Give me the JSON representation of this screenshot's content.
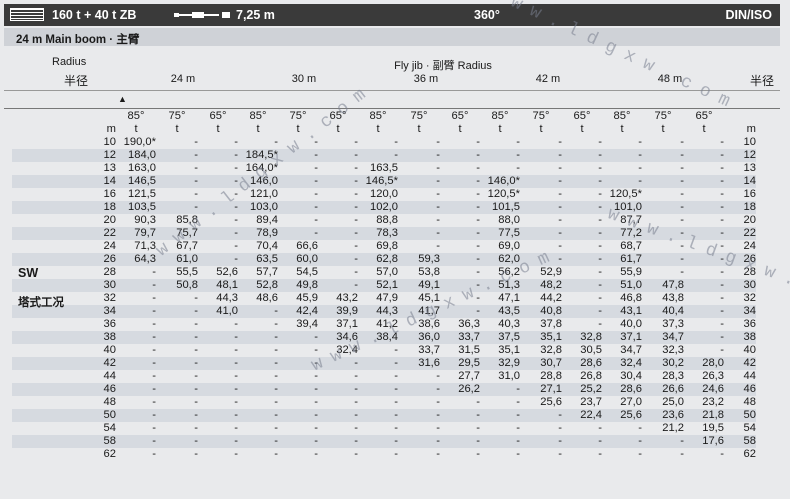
{
  "header": {
    "capacity_label": "160 t + 40 t ZB",
    "boom_length": "7,25 m",
    "slew": "360°",
    "standard": "DIN/ISO"
  },
  "subheader": {
    "label": "24 m  Main boom · 主臂"
  },
  "columns": {
    "radius_label_en": "Radius",
    "radius_label_cn": "半径",
    "radius_label_cn_right": "半径",
    "jib_title": "Fly jib · 副臂 Radius",
    "jib_lengths": [
      "24 m",
      "30 m",
      "36 m",
      "42 m",
      "48 m"
    ],
    "triangle": "▲",
    "angles": [
      "85°",
      "75°",
      "65°",
      "85°",
      "75°",
      "65°",
      "85°",
      "75°",
      "65°",
      "85°",
      "75°",
      "65°",
      "85°",
      "75°",
      "65°"
    ],
    "unit_m": "m",
    "unit_t": "t"
  },
  "side_label": {
    "code": "SW",
    "cn": "塔式工况"
  },
  "watermark": "www.ldgxw.com",
  "rows": [
    {
      "r": "10",
      "v": [
        "190,0*",
        "-",
        "-",
        "-",
        "-",
        "-",
        "-",
        "-",
        "-",
        "-",
        "-",
        "-",
        "-",
        "-",
        "-"
      ]
    },
    {
      "r": "12",
      "v": [
        "184,0",
        "-",
        "-",
        "184,5*",
        "-",
        "-",
        "-",
        "-",
        "-",
        "-",
        "-",
        "-",
        "-",
        "-",
        "-"
      ]
    },
    {
      "r": "13",
      "v": [
        "163,0",
        "-",
        "-",
        "164,0*",
        "-",
        "-",
        "163,5",
        "-",
        "-",
        "-",
        "-",
        "-",
        "-",
        "-",
        "-"
      ]
    },
    {
      "r": "14",
      "v": [
        "146,5",
        "-",
        "-",
        "146,0",
        "-",
        "-",
        "146,5*",
        "-",
        "-",
        "146,0*",
        "-",
        "-",
        "-",
        "-",
        "-"
      ]
    },
    {
      "r": "16",
      "v": [
        "121,5",
        "-",
        "-",
        "121,0",
        "-",
        "-",
        "120,0",
        "-",
        "-",
        "120,5*",
        "-",
        "-",
        "120,5*",
        "-",
        "-"
      ]
    },
    {
      "r": "18",
      "v": [
        "103,5",
        "-",
        "-",
        "103,0",
        "-",
        "-",
        "102,0",
        "-",
        "-",
        "101,5",
        "-",
        "-",
        "101,0",
        "-",
        "-"
      ]
    },
    {
      "r": "20",
      "v": [
        "90,3",
        "85,8",
        "-",
        "89,4",
        "-",
        "-",
        "88,8",
        "-",
        "-",
        "88,0",
        "-",
        "-",
        "87,7",
        "-",
        "-"
      ]
    },
    {
      "r": "22",
      "v": [
        "79,7",
        "75,7",
        "-",
        "78,9",
        "-",
        "-",
        "78,3",
        "-",
        "-",
        "77,5",
        "-",
        "-",
        "77,2",
        "-",
        "-"
      ]
    },
    {
      "r": "24",
      "v": [
        "71,3",
        "67,7",
        "-",
        "70,4",
        "66,6",
        "-",
        "69,8",
        "-",
        "-",
        "69,0",
        "-",
        "-",
        "68,7",
        "-",
        "-"
      ]
    },
    {
      "r": "26",
      "v": [
        "64,3",
        "61,0",
        "-",
        "63,5",
        "60,0",
        "-",
        "62,8",
        "59,3",
        "-",
        "62,0",
        "-",
        "-",
        "61,7",
        "-",
        "-"
      ]
    },
    {
      "r": "28",
      "v": [
        "-",
        "55,5",
        "52,6",
        "57,7",
        "54,5",
        "-",
        "57,0",
        "53,8",
        "-",
        "56,2",
        "52,9",
        "-",
        "55,9",
        "-",
        "-"
      ]
    },
    {
      "r": "30",
      "v": [
        "-",
        "50,8",
        "48,1",
        "52,8",
        "49,8",
        "-",
        "52,1",
        "49,1",
        "-",
        "51,3",
        "48,2",
        "-",
        "51,0",
        "47,8",
        "-"
      ]
    },
    {
      "r": "32",
      "v": [
        "-",
        "-",
        "44,3",
        "48,6",
        "45,9",
        "43,2",
        "47,9",
        "45,1",
        "-",
        "47,1",
        "44,2",
        "-",
        "46,8",
        "43,8",
        "-"
      ]
    },
    {
      "r": "34",
      "v": [
        "-",
        "-",
        "41,0",
        "-",
        "42,4",
        "39,9",
        "44,3",
        "41,7",
        "-",
        "43,5",
        "40,8",
        "-",
        "43,1",
        "40,4",
        "-"
      ]
    },
    {
      "r": "36",
      "v": [
        "-",
        "-",
        "-",
        "-",
        "39,4",
        "37,1",
        "41,2",
        "38,6",
        "36,3",
        "40,3",
        "37,8",
        "-",
        "40,0",
        "37,3",
        "-"
      ]
    },
    {
      "r": "38",
      "v": [
        "-",
        "-",
        "-",
        "-",
        "-",
        "34,6",
        "38,4",
        "36,0",
        "33,7",
        "37,5",
        "35,1",
        "32,8",
        "37,1",
        "34,7",
        "-"
      ]
    },
    {
      "r": "40",
      "v": [
        "-",
        "-",
        "-",
        "-",
        "-",
        "32,4",
        "-",
        "33,7",
        "31,5",
        "35,1",
        "32,8",
        "30,5",
        "34,7",
        "32,3",
        "-"
      ]
    },
    {
      "r": "42",
      "v": [
        "-",
        "-",
        "-",
        "-",
        "-",
        "-",
        "-",
        "31,6",
        "29,5",
        "32,9",
        "30,7",
        "28,6",
        "32,4",
        "30,2",
        "28,0"
      ]
    },
    {
      "r": "44",
      "v": [
        "-",
        "-",
        "-",
        "-",
        "-",
        "-",
        "-",
        "-",
        "27,7",
        "31,0",
        "28,8",
        "26,8",
        "30,4",
        "28,3",
        "26,3"
      ]
    },
    {
      "r": "46",
      "v": [
        "-",
        "-",
        "-",
        "-",
        "-",
        "-",
        "-",
        "-",
        "26,2",
        "-",
        "27,1",
        "25,2",
        "28,6",
        "26,6",
        "24,6"
      ]
    },
    {
      "r": "48",
      "v": [
        "-",
        "-",
        "-",
        "-",
        "-",
        "-",
        "-",
        "-",
        "-",
        "-",
        "25,6",
        "23,7",
        "27,0",
        "25,0",
        "23,2"
      ]
    },
    {
      "r": "50",
      "v": [
        "-",
        "-",
        "-",
        "-",
        "-",
        "-",
        "-",
        "-",
        "-",
        "-",
        "-",
        "22,4",
        "25,6",
        "23,6",
        "21,8"
      ]
    },
    {
      "r": "54",
      "v": [
        "-",
        "-",
        "-",
        "-",
        "-",
        "-",
        "-",
        "-",
        "-",
        "-",
        "-",
        "-",
        "-",
        "21,2",
        "19,5"
      ]
    },
    {
      "r": "58",
      "v": [
        "-",
        "-",
        "-",
        "-",
        "-",
        "-",
        "-",
        "-",
        "-",
        "-",
        "-",
        "-",
        "-",
        "-",
        "17,6"
      ]
    },
    {
      "r": "62",
      "v": [
        "-",
        "-",
        "-",
        "-",
        "-",
        "-",
        "-",
        "-",
        "-",
        "-",
        "-",
        "-",
        "-",
        "-",
        "-"
      ]
    }
  ]
}
